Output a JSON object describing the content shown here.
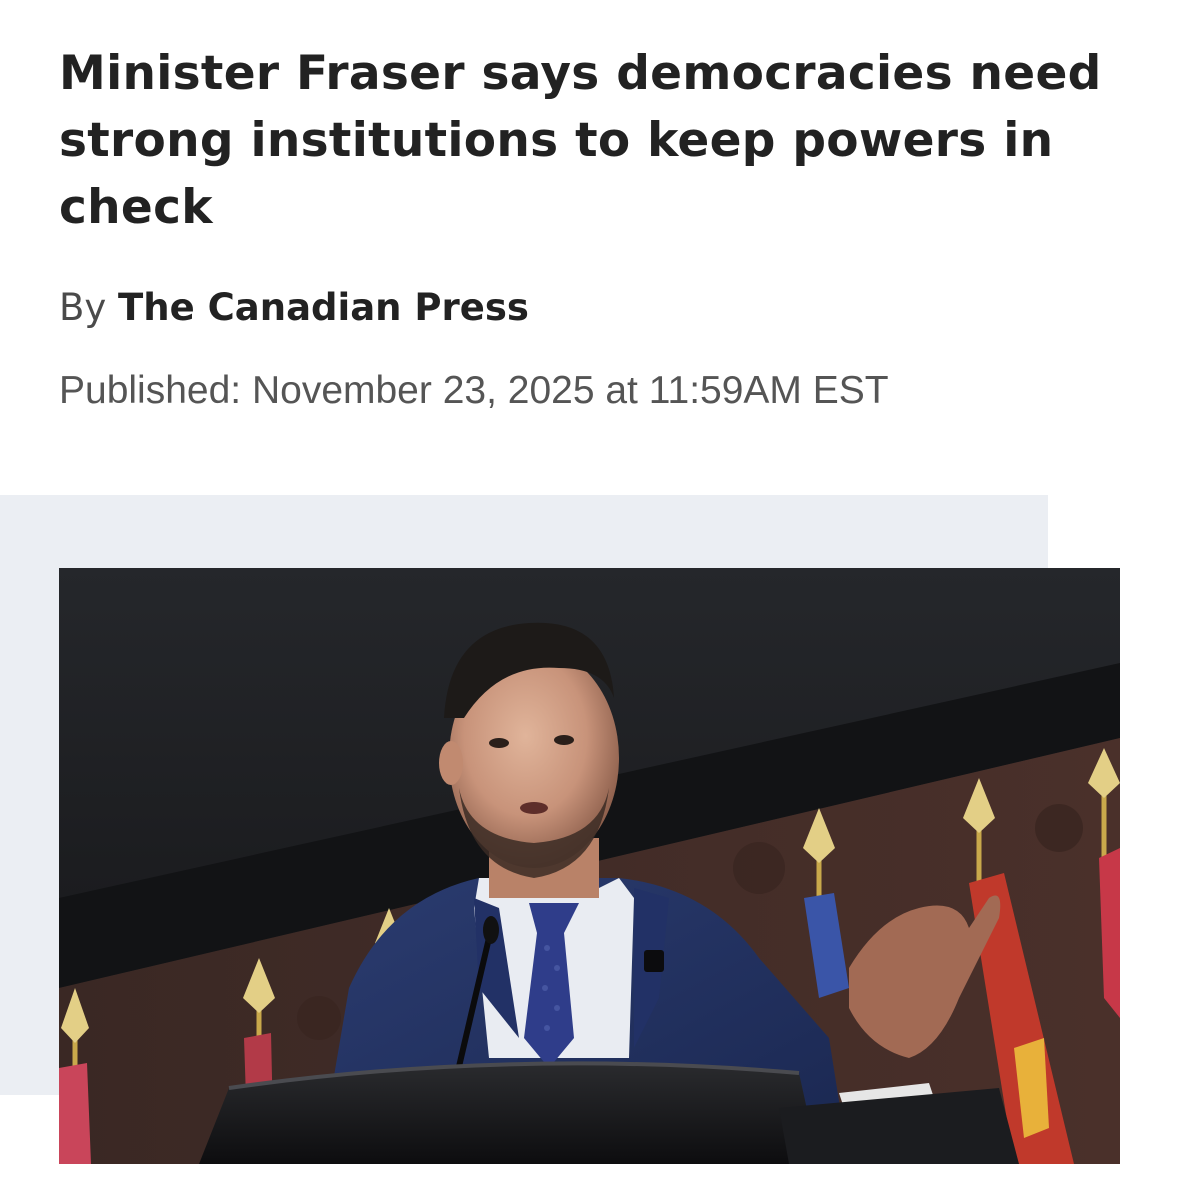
{
  "article": {
    "headline": "Minister Fraser says democracies need strong institutions to keep powers in check",
    "byline_prefix": "By",
    "author": "The Canadian Press",
    "published": "Published: November 23, 2025 at 11:59AM EST"
  },
  "colors": {
    "background": "#ffffff",
    "headline": "#222222",
    "meta_text": "#555555",
    "image_panel": "#ebeef3"
  }
}
